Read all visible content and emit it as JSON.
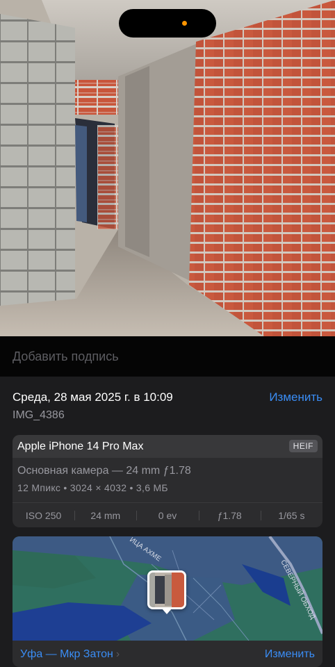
{
  "caption": {
    "placeholder": "Добавить подпись"
  },
  "info": {
    "date": "Среда, 28 мая 2025 г. в 10:09",
    "edit_label": "Изменить",
    "filename": "IMG_4386"
  },
  "camera": {
    "model": "Apple iPhone 14 Pro Max",
    "format_badge": "HEIF",
    "lens": "Основная камера — 24 mm ƒ1.78",
    "spec": "12 Мпикс • 3024 × 4032 • 3,6 МБ",
    "exif": [
      "ISO 250",
      "24 mm",
      "0 ev",
      "ƒ1.78",
      "1/65 s"
    ]
  },
  "map": {
    "street_label_1": "ИЦА АХМЕ",
    "street_label_2": "СЕВЕРНЫЙ ОБХОД",
    "location": "Уфа — Мкр Затон",
    "location_chevron": "›",
    "edit_label": "Изменить"
  },
  "colors": {
    "accent": "#3a8df5",
    "sheet": "#1c1c1e",
    "card": "#2c2c2e",
    "status_dot": "#ff9500"
  }
}
